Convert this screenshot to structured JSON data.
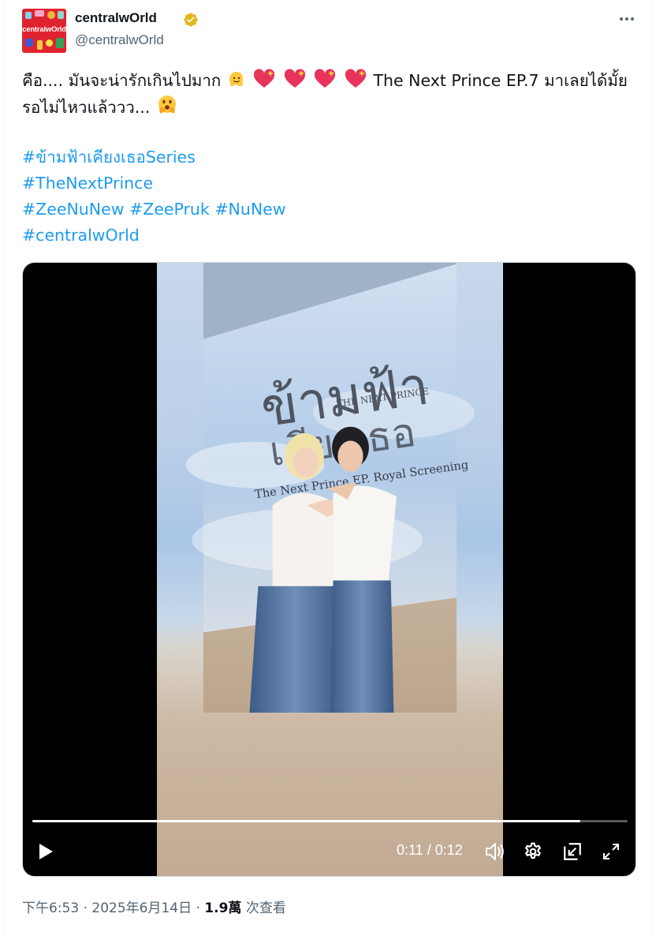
{
  "post": {
    "account": {
      "display_name": "centralwOrld",
      "handle": "@centralwOrld",
      "avatar_text": "centralwOrld",
      "verified": true
    },
    "text_line_1a": "คือ.... มันจะน่ารักเกินไปมาก",
    "text_line_1b": "The Next Prince EP.7 มาเลยได้มั้ย",
    "text_line_2": "รอไม่ไหวแล้ววว...",
    "hashtags": {
      "tag1": "#ข้ามฟ้าเคียงเธอSeries",
      "tag2": "#TheNextPrince",
      "tag3a": "#ZeeNuNew",
      "tag3b": "#ZeePruk",
      "tag3c": "#NuNew",
      "tag4": "#centralwOrld"
    },
    "video": {
      "time_display": "0:11 / 0:12",
      "progress": 0.92,
      "screen_title": "ข้ามฟ้า",
      "screen_title2": "เคียงเธอ",
      "screen_sub": "THE NEXT PRINCE",
      "screen_line": "The Next Prince EP. Royal Screening"
    },
    "footer": {
      "timestamp": "下午6:53 · 2025年6月14日 ·",
      "views_count": "1.9萬",
      "views_label": "次查看"
    }
  },
  "icons": {
    "more": "more-horizontal-icon",
    "verified": "verified-badge-icon",
    "play": "play-icon",
    "volume": "volume-icon",
    "settings": "settings-gear-icon",
    "popout": "popout-icon",
    "fullscreen": "fullscreen-icon"
  },
  "colors": {
    "link": "#1d9bf0",
    "text": "#0f1419",
    "secondary": "#536471",
    "verified": "#e2b719",
    "brand": "#e0242f"
  }
}
